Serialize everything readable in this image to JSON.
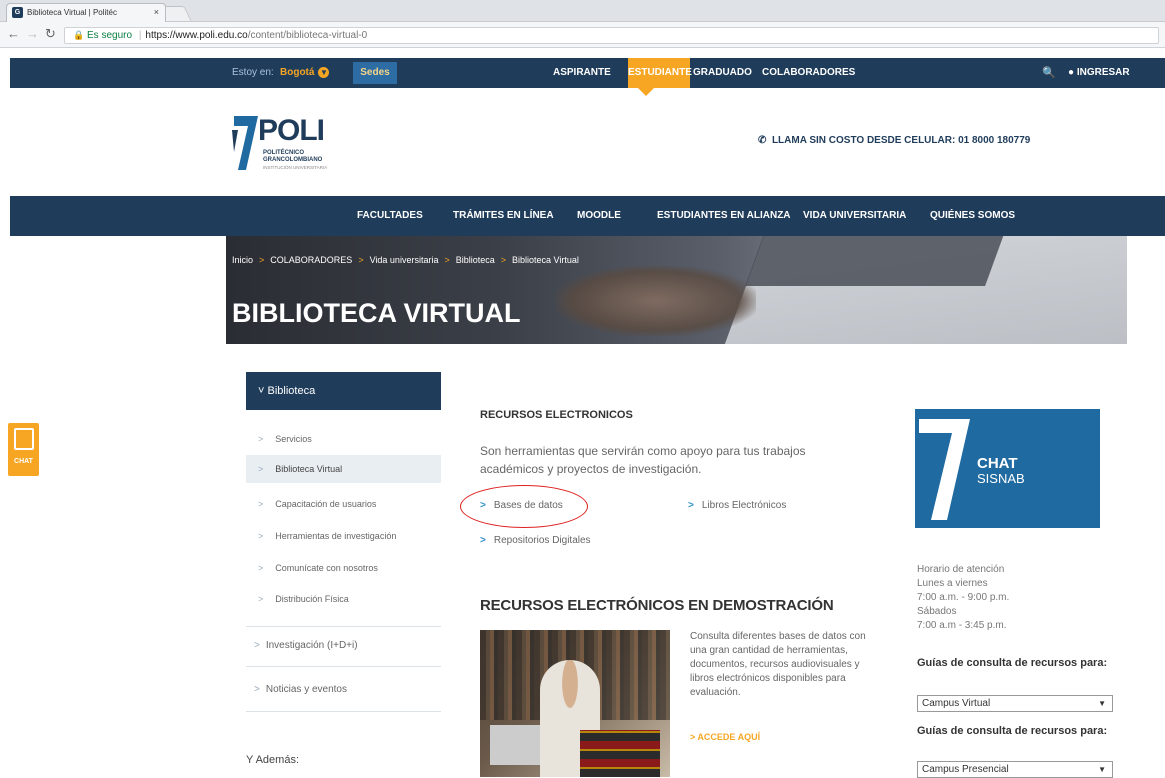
{
  "browser": {
    "tab_title": "Biblioteca Virtual | Politéc",
    "tab_close": "×",
    "secure_label": "Es seguro",
    "url_host": "https://www.poli.edu.co",
    "url_path": "/content/biblioteca-virtual-0"
  },
  "topbar": {
    "location_label": "Estoy en:",
    "location_value": "Bogotá",
    "sedes": "Sedes",
    "items": [
      "ASPIRANTE",
      "ESTUDIANTE",
      "GRADUADO",
      "COLABORADORES"
    ],
    "login": "INGRESAR"
  },
  "header": {
    "logo_text": "POLI",
    "logo_sub1": "POLITÉCNICO",
    "logo_sub2": "GRANCOLOMBIANO",
    "logo_sub3": "INSTITUCIÓN UNIVERSITARIA",
    "phone": "LLAMA SIN COSTO DESDE CELULAR: 01 8000 180779"
  },
  "mainnav": {
    "items": [
      "FACULTADES",
      "TRÁMITES EN LÍNEA",
      "MOODLE",
      "ESTUDIANTES EN ALIANZA",
      "VIDA UNIVERSITARIA",
      "QUIÉNES SOMOS"
    ]
  },
  "breadcrumb": [
    "Inicio",
    "COLABORADORES",
    "Vida universitaria",
    "Biblioteca",
    "Biblioteca Virtual"
  ],
  "hero": {
    "title": "BIBLIOTECA VIRTUAL"
  },
  "chat_side": {
    "label": "CHAT"
  },
  "sidebar": {
    "header": "Biblioteca",
    "items": [
      "Servicios",
      "Biblioteca Virtual",
      "Capacitación de usuarios",
      "Herramientas de investigación",
      "Comunícate con nosotros",
      "Distribución Física"
    ],
    "sections": [
      "Investigación (I+D+i)",
      "Noticias y eventos"
    ],
    "ademas": "Y Además:"
  },
  "content": {
    "rec_title": "RECURSOS ELECTRONICOS",
    "rec_desc": "Son herramientas que servirán como apoyo para tus trabajos académicos y proyectos de investigación.",
    "links": [
      "Bases de datos",
      "Libros Electrónicos",
      "Repositorios Digitales"
    ],
    "demo_title": "RECURSOS ELECTRÓNICOS EN DEMOSTRACIÓN",
    "demo_desc": "Consulta diferentes bases de datos con una gran cantidad de herramientas, documentos, recursos audiovisuales y libros electrónicos disponibles para evaluación.",
    "accede": "> ACCEDE AQUÍ"
  },
  "right": {
    "chat_line1": "CHAT",
    "chat_line2": "SISNAB",
    "hours": [
      "Horario de atención",
      "Lunes a viernes",
      "7:00 a.m. - 9:00 p.m.",
      "Sábados",
      "7:00 a.m - 3:45 p.m."
    ],
    "guia_label": "Guías de consulta de recursos para:",
    "select1": "Campus Virtual",
    "select2": "Campus Presencial"
  },
  "colors": {
    "navy": "#1f3c5a",
    "gold": "#f6a623",
    "link_blue": "#2d8fc9",
    "highlight_red": "#dd2222"
  }
}
